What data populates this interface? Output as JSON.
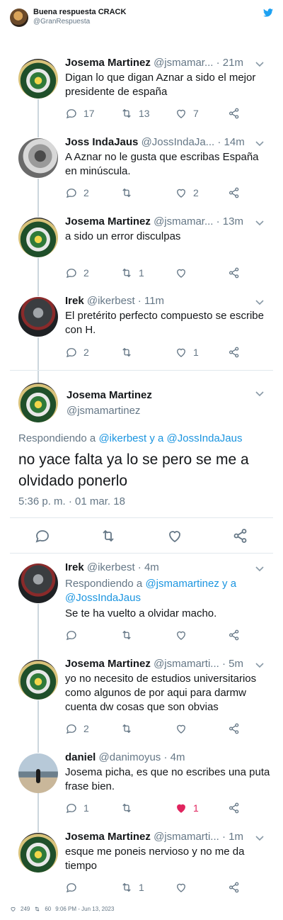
{
  "header": {
    "name": "Buena respuesta CRACK",
    "handle": "@GranRespuesta"
  },
  "tweets": [
    {
      "name": "Josema Martinez",
      "handle": "@jsmamar...",
      "time": "· 21m",
      "text": "Digan lo que digan  Aznar a sido el mejor presidente de españa",
      "replies": "17",
      "retweets": "13",
      "likes": "7"
    },
    {
      "name": "Joss IndaJaus",
      "handle": "@JossIndaJa...",
      "time": "· 14m",
      "text": "A Aznar no le gusta que escribas España en minúscula.",
      "replies": "2",
      "retweets": "",
      "likes": "2"
    },
    {
      "name": "Josema Martinez",
      "handle": "@jsmamar...",
      "time": "· 13m",
      "text": "a sido un error disculpas",
      "replies": "2",
      "retweets": "1",
      "likes": ""
    },
    {
      "name": "Irek",
      "handle": "@ikerbest",
      "time": "· 11m",
      "text": "El pretérito perfecto compuesto se escribe con H.",
      "replies": "2",
      "retweets": "",
      "likes": "1"
    }
  ],
  "main": {
    "name": "Josema Martinez",
    "handle": "@jsmamartinez",
    "reply_prefix": "Respondiendo a",
    "reply_user1": "@ikerbest",
    "reply_and": "y a",
    "reply_user2": "@JossIndaJaus",
    "text": "no yace falta ya lo se pero se me a olvidado ponerlo",
    "timestamp": "5:36 p. m. · 01 mar. 18"
  },
  "replies": [
    {
      "name": "Irek",
      "handle": "@ikerbest",
      "time": "· 4m",
      "reply_prefix": "Respondiendo a",
      "reply_user1": "@jsmamartinez",
      "reply_and": "y a",
      "reply_user2": "@JossIndaJaus",
      "text": "Se te ha vuelto a olvidar macho.",
      "replies": "",
      "retweets": "",
      "likes": ""
    },
    {
      "name": "Josema Martinez",
      "handle": "@jsmamarti...",
      "time": "· 5m",
      "text": "yo no necesito de estudios universitarios como algunos de por aqui para darmw cuenta dw cosas que son obvias",
      "replies": "2",
      "retweets": "",
      "likes": ""
    },
    {
      "name": "daniel",
      "handle": "@danimoyus",
      "time": "· 4m",
      "text": "Josema picha, es que no escribes una puta frase bien.",
      "replies": "1",
      "retweets": "",
      "likes": "1"
    },
    {
      "name": "Josema Martinez",
      "handle": "@jsmamarti...",
      "time": "· 1m",
      "text": "esque me poneis nervioso y no me da tiempo",
      "replies": "",
      "retweets": "1",
      "likes": ""
    }
  ],
  "footer": {
    "likes": "249",
    "retweets": "60",
    "timestamp": "9:06 PM - Jun 13, 2023"
  },
  "colors": {
    "accent": "#1b95e0",
    "muted": "#657786",
    "like": "#e0245e",
    "border": "#e1e8ed"
  }
}
